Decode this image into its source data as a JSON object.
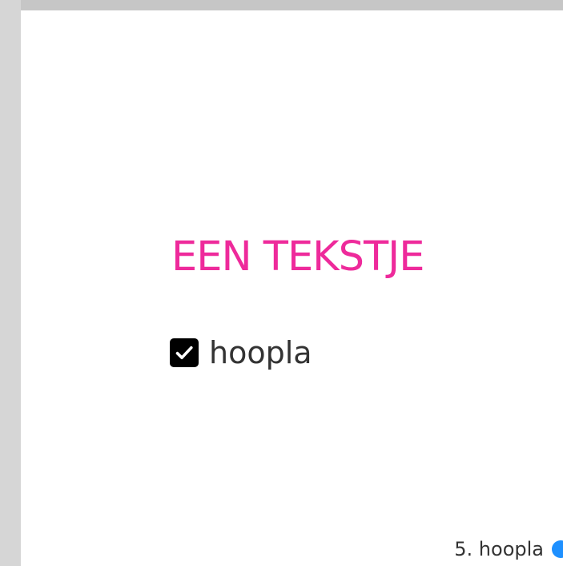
{
  "slide": {
    "title": "EEN TEKSTJE",
    "title_color": "#ee2a9b",
    "checkbox": {
      "label": "hoopla",
      "checked": true
    },
    "footer": {
      "label": "5. hoopla",
      "dot_color": "#1e90ff"
    }
  },
  "icons": {
    "check": "check-mark-icon",
    "status": "status-dot-icon"
  }
}
